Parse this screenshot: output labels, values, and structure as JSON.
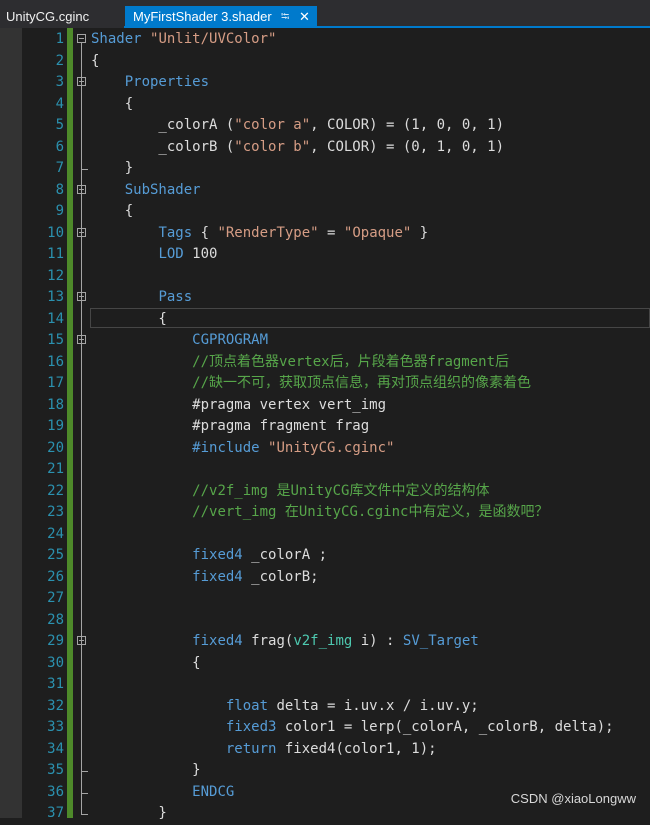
{
  "tabs": [
    {
      "label": "UnityCG.cginc",
      "active": false
    },
    {
      "label": "MyFirstShader 3.shader",
      "active": true
    }
  ],
  "tab_icons": {
    "pin": "pin-icon",
    "close": "close-icon"
  },
  "colors": {
    "background": "#1e1e1e",
    "tab_active": "#007acc",
    "line_number": "#2b91af",
    "keyword": "#569cd6",
    "string": "#d69d85",
    "comment": "#57a64a",
    "text": "#dcdcdc",
    "change_bar": "#4e8a2a"
  },
  "lines": [
    {
      "num": "1",
      "tokens": [
        {
          "t": "Shader",
          "c": "#569cd6"
        },
        {
          "t": " "
        },
        {
          "t": "\"Unlit/UVColor\"",
          "c": "#d69d85"
        }
      ]
    },
    {
      "num": "2",
      "tokens": [
        {
          "t": "{"
        }
      ]
    },
    {
      "num": "3",
      "tokens": [
        {
          "t": "    "
        },
        {
          "t": "Properties",
          "c": "#569cd6"
        }
      ]
    },
    {
      "num": "4",
      "tokens": [
        {
          "t": "    {"
        }
      ]
    },
    {
      "num": "5",
      "tokens": [
        {
          "t": "        _colorA ("
        },
        {
          "t": "\"color a\"",
          "c": "#d69d85"
        },
        {
          "t": ", COLOR) = (1, 0, 0, 1)"
        }
      ]
    },
    {
      "num": "6",
      "tokens": [
        {
          "t": "        _colorB ("
        },
        {
          "t": "\"color b\"",
          "c": "#d69d85"
        },
        {
          "t": ", COLOR) = (0, 1, 0, 1)"
        }
      ]
    },
    {
      "num": "7",
      "tokens": [
        {
          "t": "    }"
        }
      ]
    },
    {
      "num": "8",
      "tokens": [
        {
          "t": "    "
        },
        {
          "t": "SubShader",
          "c": "#569cd6"
        }
      ]
    },
    {
      "num": "9",
      "tokens": [
        {
          "t": "    {"
        }
      ]
    },
    {
      "num": "10",
      "tokens": [
        {
          "t": "        "
        },
        {
          "t": "Tags",
          "c": "#569cd6"
        },
        {
          "t": " { "
        },
        {
          "t": "\"RenderType\"",
          "c": "#d69d85"
        },
        {
          "t": " = "
        },
        {
          "t": "\"Opaque\"",
          "c": "#d69d85"
        },
        {
          "t": " }"
        }
      ]
    },
    {
      "num": "11",
      "tokens": [
        {
          "t": "        "
        },
        {
          "t": "LOD",
          "c": "#569cd6"
        },
        {
          "t": " 100"
        }
      ]
    },
    {
      "num": "12",
      "tokens": []
    },
    {
      "num": "13",
      "tokens": [
        {
          "t": "        "
        },
        {
          "t": "Pass",
          "c": "#569cd6"
        }
      ]
    },
    {
      "num": "14",
      "tokens": [
        {
          "t": "        {"
        }
      ]
    },
    {
      "num": "15",
      "tokens": [
        {
          "t": "            "
        },
        {
          "t": "CGPROGRAM",
          "c": "#569cd6"
        }
      ]
    },
    {
      "num": "16",
      "tokens": [
        {
          "t": "            "
        },
        {
          "t": "//顶点着色器vertex后，片段着色器fragment后",
          "c": "#57a64a"
        }
      ]
    },
    {
      "num": "17",
      "tokens": [
        {
          "t": "            "
        },
        {
          "t": "//缺一不可，获取顶点信息，再对顶点组织的像素着色",
          "c": "#57a64a"
        }
      ]
    },
    {
      "num": "18",
      "tokens": [
        {
          "t": "            #pragma vertex vert_img"
        }
      ]
    },
    {
      "num": "19",
      "tokens": [
        {
          "t": "            #pragma fragment frag"
        }
      ]
    },
    {
      "num": "20",
      "tokens": [
        {
          "t": "            "
        },
        {
          "t": "#include",
          "c": "#569cd6"
        },
        {
          "t": " "
        },
        {
          "t": "\"UnityCG.cginc\"",
          "c": "#d69d85"
        }
      ]
    },
    {
      "num": "21",
      "tokens": []
    },
    {
      "num": "22",
      "tokens": [
        {
          "t": "            "
        },
        {
          "t": "//v2f_img 是UnityCG库文件中定义的结构体",
          "c": "#57a64a"
        }
      ]
    },
    {
      "num": "23",
      "tokens": [
        {
          "t": "            "
        },
        {
          "t": "//vert_img 在UnityCG.cginc中有定义，是函数吧？",
          "c": "#57a64a"
        }
      ]
    },
    {
      "num": "24",
      "tokens": []
    },
    {
      "num": "25",
      "tokens": [
        {
          "t": "            "
        },
        {
          "t": "fixed4",
          "c": "#569cd6"
        },
        {
          "t": " _colorA ;"
        }
      ]
    },
    {
      "num": "26",
      "tokens": [
        {
          "t": "            "
        },
        {
          "t": "fixed4",
          "c": "#569cd6"
        },
        {
          "t": " _colorB;"
        }
      ]
    },
    {
      "num": "27",
      "tokens": []
    },
    {
      "num": "28",
      "tokens": []
    },
    {
      "num": "29",
      "tokens": [
        {
          "t": "            "
        },
        {
          "t": "fixed4",
          "c": "#569cd6"
        },
        {
          "t": " frag("
        },
        {
          "t": "v2f_img",
          "c": "#4ec9b0"
        },
        {
          "t": " i) : "
        },
        {
          "t": "SV_Target",
          "c": "#569cd6"
        }
      ]
    },
    {
      "num": "30",
      "tokens": [
        {
          "t": "            {"
        }
      ]
    },
    {
      "num": "31",
      "tokens": []
    },
    {
      "num": "32",
      "tokens": [
        {
          "t": "                "
        },
        {
          "t": "float",
          "c": "#569cd6"
        },
        {
          "t": " delta = i.uv.x / i.uv.y;"
        }
      ]
    },
    {
      "num": "33",
      "tokens": [
        {
          "t": "                "
        },
        {
          "t": "fixed3",
          "c": "#569cd6"
        },
        {
          "t": " color1 = lerp(_colorA, _colorB, delta);"
        }
      ]
    },
    {
      "num": "34",
      "tokens": [
        {
          "t": "                "
        },
        {
          "t": "return",
          "c": "#569cd6"
        },
        {
          "t": " fixed4(color1, 1);"
        }
      ]
    },
    {
      "num": "35",
      "tokens": [
        {
          "t": "            }"
        }
      ]
    },
    {
      "num": "36",
      "tokens": [
        {
          "t": "            "
        },
        {
          "t": "ENDCG",
          "c": "#569cd6"
        }
      ]
    },
    {
      "num": "37",
      "tokens": [
        {
          "t": "        }"
        }
      ]
    }
  ],
  "fold_lines": [
    "1",
    "3",
    "8",
    "10",
    "13",
    "15",
    "29"
  ],
  "current_line": "14",
  "watermark": "CSDN @xiaoLongww"
}
